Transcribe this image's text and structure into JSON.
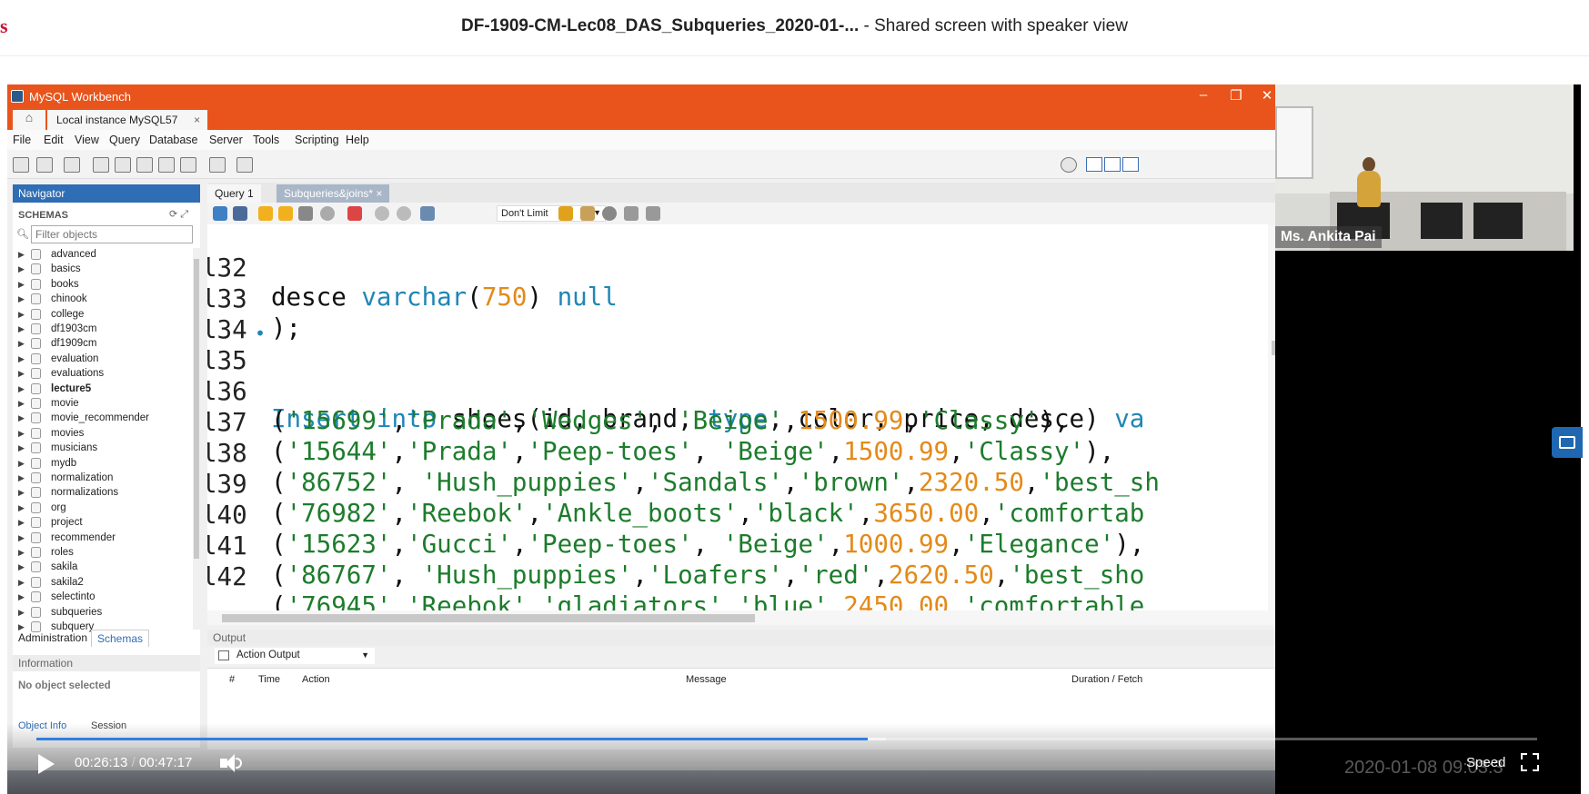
{
  "header": {
    "brand_letter": "s",
    "meeting_title": "DF-1909-CM-Lec08_DAS_Subqueries_2020-01-...",
    "meeting_suffix": "- Shared screen with speaker view"
  },
  "window": {
    "title": "MySQL Workbench",
    "connection_tab": "Local instance MySQL57",
    "menu": [
      "File",
      "Edit",
      "View",
      "Query",
      "Database",
      "Server",
      "Tools",
      "Scripting",
      "Help"
    ]
  },
  "navigator": {
    "header": "Navigator",
    "schemas_label": "SCHEMAS",
    "filter_placeholder": "Filter objects",
    "schemas": [
      "advanced",
      "basics",
      "books",
      "chinook",
      "college",
      "df1903cm",
      "df1909cm",
      "evaluation",
      "evaluations",
      "lecture5",
      "movie",
      "movie_recommender",
      "movies",
      "musicians",
      "mydb",
      "normalization",
      "normalizations",
      "org",
      "project",
      "recommender",
      "roles",
      "sakila",
      "sakila2",
      "selectinto",
      "subqueries",
      "subquery"
    ],
    "active_schema": "lecture5",
    "tab_admin": "Administration",
    "tab_schemas": "Schemas",
    "info_header": "Information",
    "info_text": "No object selected",
    "bottom_tab_object": "Object Info",
    "bottom_tab_session": "Session"
  },
  "editor": {
    "tab_query1": "Query 1",
    "tab_file": "Subqueries&joins*",
    "limit_value": "Don't Limit"
  },
  "output": {
    "header": "Output",
    "selector": "Action Output",
    "columns": [
      "#",
      "Time",
      "Action",
      "Message",
      "Duration / Fetch"
    ]
  },
  "speaker": {
    "name": "Ms. Ankita Pai"
  },
  "player": {
    "current_time": "00:26:13",
    "separator": "/",
    "total_time": "00:47:17",
    "progress_fraction": 0.554,
    "buffer_fraction": 0.566,
    "speed_label": "Speed",
    "watermark": "2020-01-08  09:03:3"
  },
  "colors": {
    "accent": "#e8541b",
    "nav_blue": "#2f6db5",
    "keyword": "#1f86b5",
    "string": "#1d7c2c",
    "number": "#e38a1a",
    "progress": "#2f7fde"
  }
}
